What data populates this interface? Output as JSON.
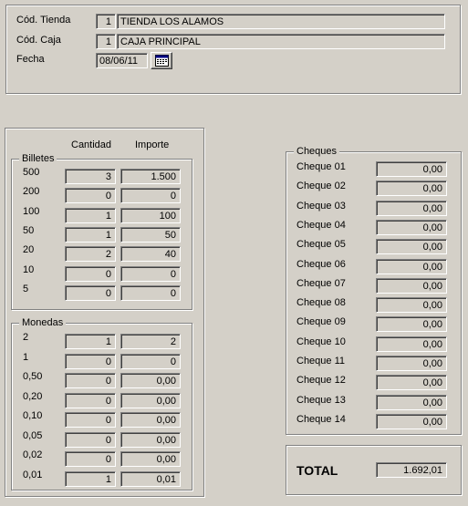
{
  "header": {
    "tienda_label": "Cód. Tienda",
    "tienda_code": "1",
    "tienda_name": "TIENDA LOS ALAMOS",
    "caja_label": "Cód. Caja",
    "caja_code": "1",
    "caja_name": "CAJA PRINCIPAL",
    "fecha_label": "Fecha",
    "fecha_value": "08/06/11",
    "calendar_icon": "calendar-icon"
  },
  "columns": {
    "cantidad": "Cantidad",
    "importe": "Importe"
  },
  "billetes": {
    "title": "Billetes",
    "rows": [
      {
        "denom": "500",
        "cantidad": "3",
        "importe": "1.500"
      },
      {
        "denom": "200",
        "cantidad": "0",
        "importe": "0"
      },
      {
        "denom": "100",
        "cantidad": "1",
        "importe": "100"
      },
      {
        "denom": "50",
        "cantidad": "1",
        "importe": "50"
      },
      {
        "denom": "20",
        "cantidad": "2",
        "importe": "40"
      },
      {
        "denom": "10",
        "cantidad": "0",
        "importe": "0"
      },
      {
        "denom": "5",
        "cantidad": "0",
        "importe": "0"
      }
    ]
  },
  "monedas": {
    "title": "Monedas",
    "rows": [
      {
        "denom": "2",
        "cantidad": "1",
        "importe": "2"
      },
      {
        "denom": "1",
        "cantidad": "0",
        "importe": "0"
      },
      {
        "denom": "0,50",
        "cantidad": "0",
        "importe": "0,00"
      },
      {
        "denom": "0,20",
        "cantidad": "0",
        "importe": "0,00"
      },
      {
        "denom": "0,10",
        "cantidad": "0",
        "importe": "0,00"
      },
      {
        "denom": "0,05",
        "cantidad": "0",
        "importe": "0,00"
      },
      {
        "denom": "0,02",
        "cantidad": "0",
        "importe": "0,00"
      },
      {
        "denom": "0,01",
        "cantidad": "1",
        "importe": "0,01"
      }
    ]
  },
  "cheques": {
    "title": "Cheques",
    "rows": [
      {
        "label": "Cheque 01",
        "value": "0,00"
      },
      {
        "label": "Cheque 02",
        "value": "0,00"
      },
      {
        "label": "Cheque 03",
        "value": "0,00"
      },
      {
        "label": "Cheque 04",
        "value": "0,00"
      },
      {
        "label": "Cheque 05",
        "value": "0,00"
      },
      {
        "label": "Cheque 06",
        "value": "0,00"
      },
      {
        "label": "Cheque 07",
        "value": "0,00"
      },
      {
        "label": "Cheque 08",
        "value": "0,00"
      },
      {
        "label": "Cheque 09",
        "value": "0,00"
      },
      {
        "label": "Cheque 10",
        "value": "0,00"
      },
      {
        "label": "Cheque 11",
        "value": "0,00"
      },
      {
        "label": "Cheque 12",
        "value": "0,00"
      },
      {
        "label": "Cheque 13",
        "value": "0,00"
      },
      {
        "label": "Cheque 14",
        "value": "0,00"
      }
    ]
  },
  "total": {
    "label": "TOTAL",
    "value": "1.692,01"
  }
}
